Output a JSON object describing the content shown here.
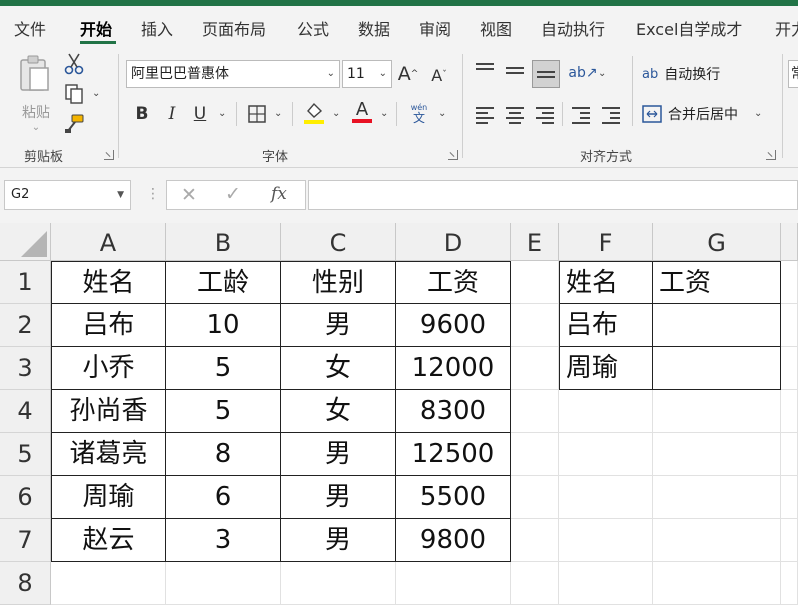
{
  "menu": {
    "tabs": [
      "文件",
      "开始",
      "插入",
      "页面布局",
      "公式",
      "数据",
      "审阅",
      "视图",
      "自动执行",
      "Excel自学成才",
      "开力"
    ]
  },
  "ribbon": {
    "clipboard": {
      "paste_label": "粘贴",
      "group_label": "剪贴板"
    },
    "font": {
      "font_name": "阿里巴巴普惠体",
      "font_size": "11",
      "grow_label": "A",
      "shrink_label": "A",
      "bold": "B",
      "italic": "I",
      "underline": "U",
      "font_color_glyph": "A",
      "highlight_color": "#ffee00",
      "font_color": "#e81123",
      "phonetic_top": "wén",
      "phonetic_bottom": "文",
      "group_label": "字体"
    },
    "alignment": {
      "wrap_text": "自动换行",
      "merge_center": "合并后居中",
      "group_label": "对齐方式",
      "wrap_glyph": "ab"
    },
    "number": {
      "partial": "常"
    }
  },
  "formula_bar": {
    "name_box": "G2",
    "fx": "fx",
    "formula": ""
  },
  "sheet": {
    "columns": [
      "A",
      "B",
      "C",
      "D",
      "E",
      "F",
      "G"
    ],
    "rows": [
      "1",
      "2",
      "3",
      "4",
      "5",
      "6",
      "7",
      "8"
    ],
    "table1": {
      "header": [
        "姓名",
        "工龄",
        "性别",
        "工资"
      ],
      "rows": [
        [
          "吕布",
          "10",
          "男",
          "9600"
        ],
        [
          "小乔",
          "5",
          "女",
          "12000"
        ],
        [
          "孙尚香",
          "5",
          "女",
          "8300"
        ],
        [
          "诸葛亮",
          "8",
          "男",
          "12500"
        ],
        [
          "周瑜",
          "6",
          "男",
          "5500"
        ],
        [
          "赵云",
          "3",
          "男",
          "9800"
        ]
      ]
    },
    "table2": {
      "header": [
        "姓名",
        "工资"
      ],
      "rows": [
        [
          "吕布",
          ""
        ],
        [
          "周瑜",
          ""
        ]
      ]
    },
    "selected_cell": "G2"
  }
}
